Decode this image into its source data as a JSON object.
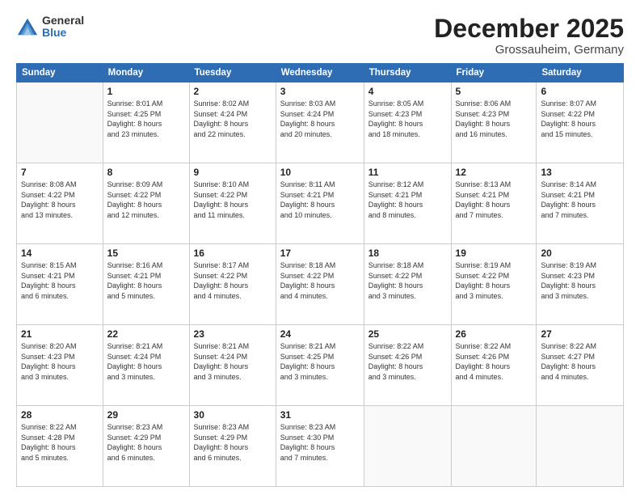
{
  "logo": {
    "general": "General",
    "blue": "Blue"
  },
  "header": {
    "month": "December 2025",
    "location": "Grossauheim, Germany"
  },
  "weekdays": [
    "Sunday",
    "Monday",
    "Tuesday",
    "Wednesday",
    "Thursday",
    "Friday",
    "Saturday"
  ],
  "weeks": [
    [
      {
        "day": "",
        "info": ""
      },
      {
        "day": "1",
        "info": "Sunrise: 8:01 AM\nSunset: 4:25 PM\nDaylight: 8 hours\nand 23 minutes."
      },
      {
        "day": "2",
        "info": "Sunrise: 8:02 AM\nSunset: 4:24 PM\nDaylight: 8 hours\nand 22 minutes."
      },
      {
        "day": "3",
        "info": "Sunrise: 8:03 AM\nSunset: 4:24 PM\nDaylight: 8 hours\nand 20 minutes."
      },
      {
        "day": "4",
        "info": "Sunrise: 8:05 AM\nSunset: 4:23 PM\nDaylight: 8 hours\nand 18 minutes."
      },
      {
        "day": "5",
        "info": "Sunrise: 8:06 AM\nSunset: 4:23 PM\nDaylight: 8 hours\nand 16 minutes."
      },
      {
        "day": "6",
        "info": "Sunrise: 8:07 AM\nSunset: 4:22 PM\nDaylight: 8 hours\nand 15 minutes."
      }
    ],
    [
      {
        "day": "7",
        "info": "Sunrise: 8:08 AM\nSunset: 4:22 PM\nDaylight: 8 hours\nand 13 minutes."
      },
      {
        "day": "8",
        "info": "Sunrise: 8:09 AM\nSunset: 4:22 PM\nDaylight: 8 hours\nand 12 minutes."
      },
      {
        "day": "9",
        "info": "Sunrise: 8:10 AM\nSunset: 4:22 PM\nDaylight: 8 hours\nand 11 minutes."
      },
      {
        "day": "10",
        "info": "Sunrise: 8:11 AM\nSunset: 4:21 PM\nDaylight: 8 hours\nand 10 minutes."
      },
      {
        "day": "11",
        "info": "Sunrise: 8:12 AM\nSunset: 4:21 PM\nDaylight: 8 hours\nand 8 minutes."
      },
      {
        "day": "12",
        "info": "Sunrise: 8:13 AM\nSunset: 4:21 PM\nDaylight: 8 hours\nand 7 minutes."
      },
      {
        "day": "13",
        "info": "Sunrise: 8:14 AM\nSunset: 4:21 PM\nDaylight: 8 hours\nand 7 minutes."
      }
    ],
    [
      {
        "day": "14",
        "info": "Sunrise: 8:15 AM\nSunset: 4:21 PM\nDaylight: 8 hours\nand 6 minutes."
      },
      {
        "day": "15",
        "info": "Sunrise: 8:16 AM\nSunset: 4:21 PM\nDaylight: 8 hours\nand 5 minutes."
      },
      {
        "day": "16",
        "info": "Sunrise: 8:17 AM\nSunset: 4:22 PM\nDaylight: 8 hours\nand 4 minutes."
      },
      {
        "day": "17",
        "info": "Sunrise: 8:18 AM\nSunset: 4:22 PM\nDaylight: 8 hours\nand 4 minutes."
      },
      {
        "day": "18",
        "info": "Sunrise: 8:18 AM\nSunset: 4:22 PM\nDaylight: 8 hours\nand 3 minutes."
      },
      {
        "day": "19",
        "info": "Sunrise: 8:19 AM\nSunset: 4:22 PM\nDaylight: 8 hours\nand 3 minutes."
      },
      {
        "day": "20",
        "info": "Sunrise: 8:19 AM\nSunset: 4:23 PM\nDaylight: 8 hours\nand 3 minutes."
      }
    ],
    [
      {
        "day": "21",
        "info": "Sunrise: 8:20 AM\nSunset: 4:23 PM\nDaylight: 8 hours\nand 3 minutes."
      },
      {
        "day": "22",
        "info": "Sunrise: 8:21 AM\nSunset: 4:24 PM\nDaylight: 8 hours\nand 3 minutes."
      },
      {
        "day": "23",
        "info": "Sunrise: 8:21 AM\nSunset: 4:24 PM\nDaylight: 8 hours\nand 3 minutes."
      },
      {
        "day": "24",
        "info": "Sunrise: 8:21 AM\nSunset: 4:25 PM\nDaylight: 8 hours\nand 3 minutes."
      },
      {
        "day": "25",
        "info": "Sunrise: 8:22 AM\nSunset: 4:26 PM\nDaylight: 8 hours\nand 3 minutes."
      },
      {
        "day": "26",
        "info": "Sunrise: 8:22 AM\nSunset: 4:26 PM\nDaylight: 8 hours\nand 4 minutes."
      },
      {
        "day": "27",
        "info": "Sunrise: 8:22 AM\nSunset: 4:27 PM\nDaylight: 8 hours\nand 4 minutes."
      }
    ],
    [
      {
        "day": "28",
        "info": "Sunrise: 8:22 AM\nSunset: 4:28 PM\nDaylight: 8 hours\nand 5 minutes."
      },
      {
        "day": "29",
        "info": "Sunrise: 8:23 AM\nSunset: 4:29 PM\nDaylight: 8 hours\nand 6 minutes."
      },
      {
        "day": "30",
        "info": "Sunrise: 8:23 AM\nSunset: 4:29 PM\nDaylight: 8 hours\nand 6 minutes."
      },
      {
        "day": "31",
        "info": "Sunrise: 8:23 AM\nSunset: 4:30 PM\nDaylight: 8 hours\nand 7 minutes."
      },
      {
        "day": "",
        "info": ""
      },
      {
        "day": "",
        "info": ""
      },
      {
        "day": "",
        "info": ""
      }
    ]
  ]
}
